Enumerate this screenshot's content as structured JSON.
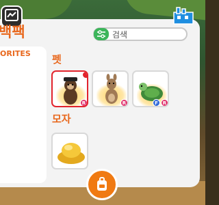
{
  "header": {
    "title": "백팩",
    "search_placeholder": "검색"
  },
  "favorites": {
    "label": "ORITES",
    "items": [
      {
        "icon": "bone-icon",
        "selected": true
      },
      {
        "icon": "pet-face-icon",
        "selected": false
      },
      {
        "icon": "toy-icon",
        "selected": false
      },
      {
        "icon": "stroller-icon",
        "selected": false
      },
      {
        "icon": "food-icon",
        "selected": false
      },
      {
        "icon": "car-icon",
        "selected": false
      },
      {
        "icon": "balloon-icon",
        "selected": false
      },
      {
        "icon": "gift-icon",
        "selected": false
      },
      {
        "icon": "tag-icon",
        "selected": false
      },
      {
        "icon": "potion-icon",
        "selected": false
      }
    ]
  },
  "categories": [
    {
      "label": "펫",
      "items": [
        {
          "name": "monkey-pet",
          "badges": [
            "R"
          ],
          "equipped": true
        },
        {
          "name": "kangaroo-pet",
          "badges": [
            "R"
          ],
          "equipped": false
        },
        {
          "name": "turtle-pet",
          "badges": [
            "F",
            "R"
          ],
          "equipped": false
        }
      ]
    },
    {
      "label": "모자",
      "items": [
        {
          "name": "gold-hat",
          "badges": [],
          "equipped": false
        }
      ]
    }
  ],
  "colors": {
    "accent": "#e8671c",
    "green": "#3cb55a",
    "rarity_r": "#e0306b",
    "flag_f": "#2f67d8",
    "equipped": "#e2232c"
  }
}
